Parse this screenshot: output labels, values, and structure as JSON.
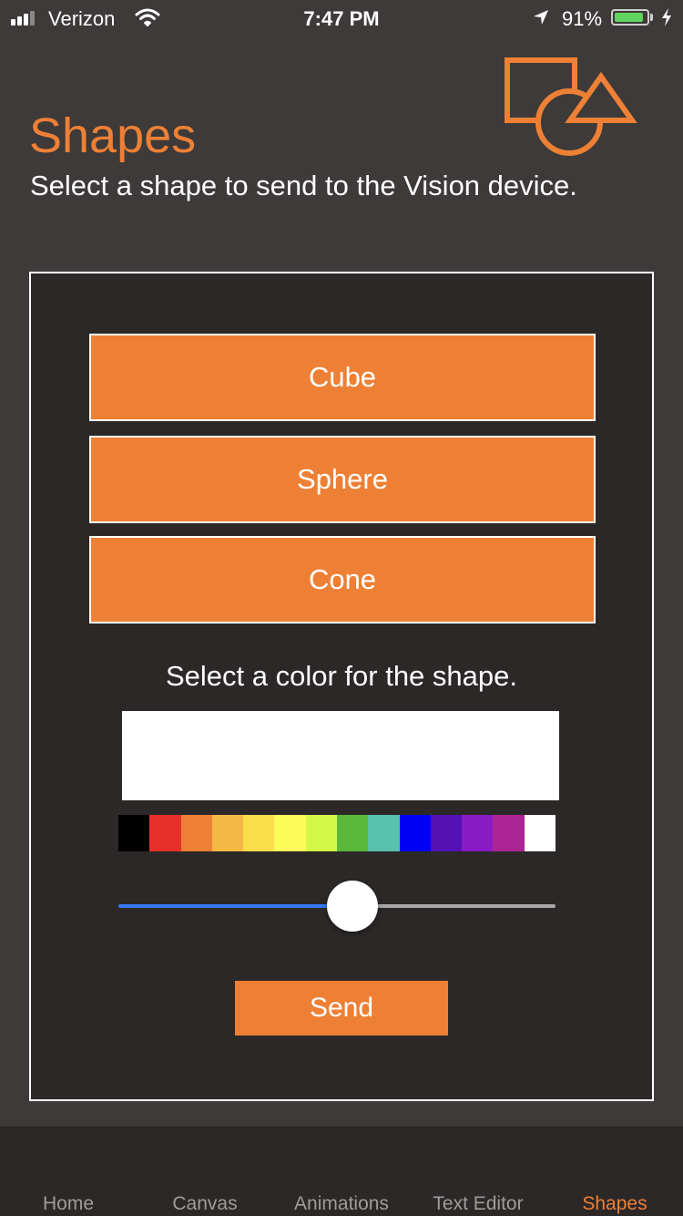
{
  "status_bar": {
    "carrier": "Verizon",
    "time": "7:47 PM",
    "battery_percent": "91%",
    "battery_level": 0.91,
    "signal_bars": 3,
    "signal_bars_total": 4
  },
  "header": {
    "title": "Shapes",
    "subtitle": "Select a shape to send to the Vision device.",
    "icon": "shapes-icon"
  },
  "shapes": {
    "buttons": [
      {
        "label": "Cube"
      },
      {
        "label": "Sphere"
      },
      {
        "label": "Cone"
      }
    ]
  },
  "color": {
    "label": "Select a color for the shape.",
    "preview_color": "#ffffff",
    "palette": [
      "#000000",
      "#e8302a",
      "#ee8035",
      "#f6b946",
      "#fbdc4a",
      "#fdfb5a",
      "#d5f746",
      "#58b93a",
      "#57c1ad",
      "#0000f5",
      "#5511b4",
      "#8a1ac4",
      "#ad2494",
      "#ffffff"
    ],
    "slider_value": 0.536
  },
  "send": {
    "label": "Send"
  },
  "tabs": [
    {
      "label": "Home",
      "active": false
    },
    {
      "label": "Canvas",
      "active": false
    },
    {
      "label": "Animations",
      "active": false
    },
    {
      "label": "Text Editor",
      "active": false
    },
    {
      "label": "Shapes",
      "active": true
    }
  ],
  "colors": {
    "accent": "#ee8035",
    "background": "#3d3a39",
    "panel": "#2c2828",
    "slider_min_track": "#3478f6",
    "slider_max_track": "#a8a8a8",
    "battery": "#5fd45f"
  }
}
